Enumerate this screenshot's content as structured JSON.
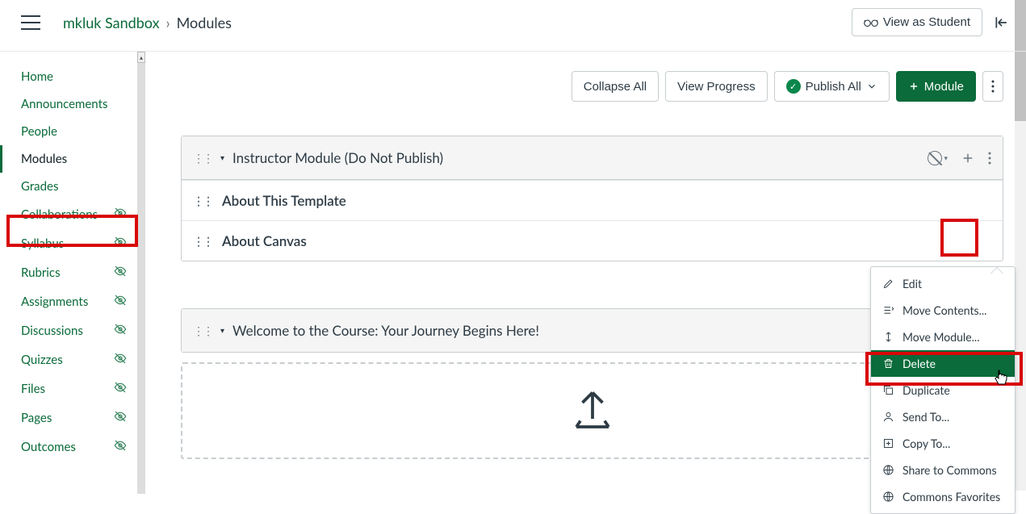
{
  "breadcrumb": {
    "course": "mkluk Sandbox",
    "page": "Modules"
  },
  "topbar": {
    "view_as_student": "View as Student"
  },
  "sidebar": {
    "items": [
      {
        "label": "Home",
        "hidden": false,
        "active": false
      },
      {
        "label": "Announcements",
        "hidden": false,
        "active": false
      },
      {
        "label": "People",
        "hidden": false,
        "active": false
      },
      {
        "label": "Modules",
        "hidden": false,
        "active": true
      },
      {
        "label": "Grades",
        "hidden": false,
        "active": false
      },
      {
        "label": "Collaborations",
        "hidden": true,
        "active": false
      },
      {
        "label": "Syllabus",
        "hidden": true,
        "active": false
      },
      {
        "label": "Rubrics",
        "hidden": true,
        "active": false
      },
      {
        "label": "Assignments",
        "hidden": true,
        "active": false
      },
      {
        "label": "Discussions",
        "hidden": true,
        "active": false
      },
      {
        "label": "Quizzes",
        "hidden": true,
        "active": false
      },
      {
        "label": "Files",
        "hidden": true,
        "active": false
      },
      {
        "label": "Pages",
        "hidden": true,
        "active": false
      },
      {
        "label": "Outcomes",
        "hidden": true,
        "active": false
      }
    ]
  },
  "actions": {
    "collapse_all": "Collapse All",
    "view_progress": "View Progress",
    "publish_all": "Publish All",
    "add_module": "Module"
  },
  "modules": [
    {
      "title": "Instructor Module (Do Not Publish)",
      "items": [
        {
          "title": "About This Template"
        },
        {
          "title": "About Canvas"
        }
      ]
    },
    {
      "title": "Welcome to the Course: Your Journey Begins Here!",
      "items": []
    }
  ],
  "menu": {
    "edit": "Edit",
    "move_contents": "Move Contents...",
    "move_module": "Move Module...",
    "delete": "Delete",
    "duplicate": "Duplicate",
    "send_to": "Send To...",
    "copy_to": "Copy To...",
    "share_commons": "Share to Commons",
    "commons_fav": "Commons Favorites"
  }
}
